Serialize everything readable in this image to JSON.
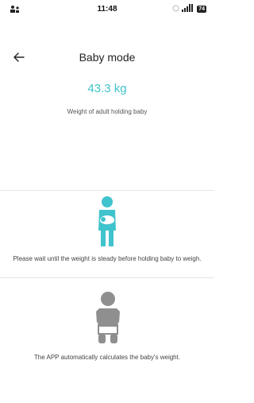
{
  "status": {
    "time": "11:48",
    "battery": "74"
  },
  "header": {
    "title": "Baby mode"
  },
  "main": {
    "weight": "43.3 kg",
    "weight_label": "Weight of adult holding baby",
    "step1_text": "Please wait until the weight is steady before holding baby to weigh.",
    "step2_text": "The APP automatically calculates the baby's weight."
  },
  "colors": {
    "accent": "#3fc3cc",
    "baby_icon": "#8f8f8f"
  }
}
